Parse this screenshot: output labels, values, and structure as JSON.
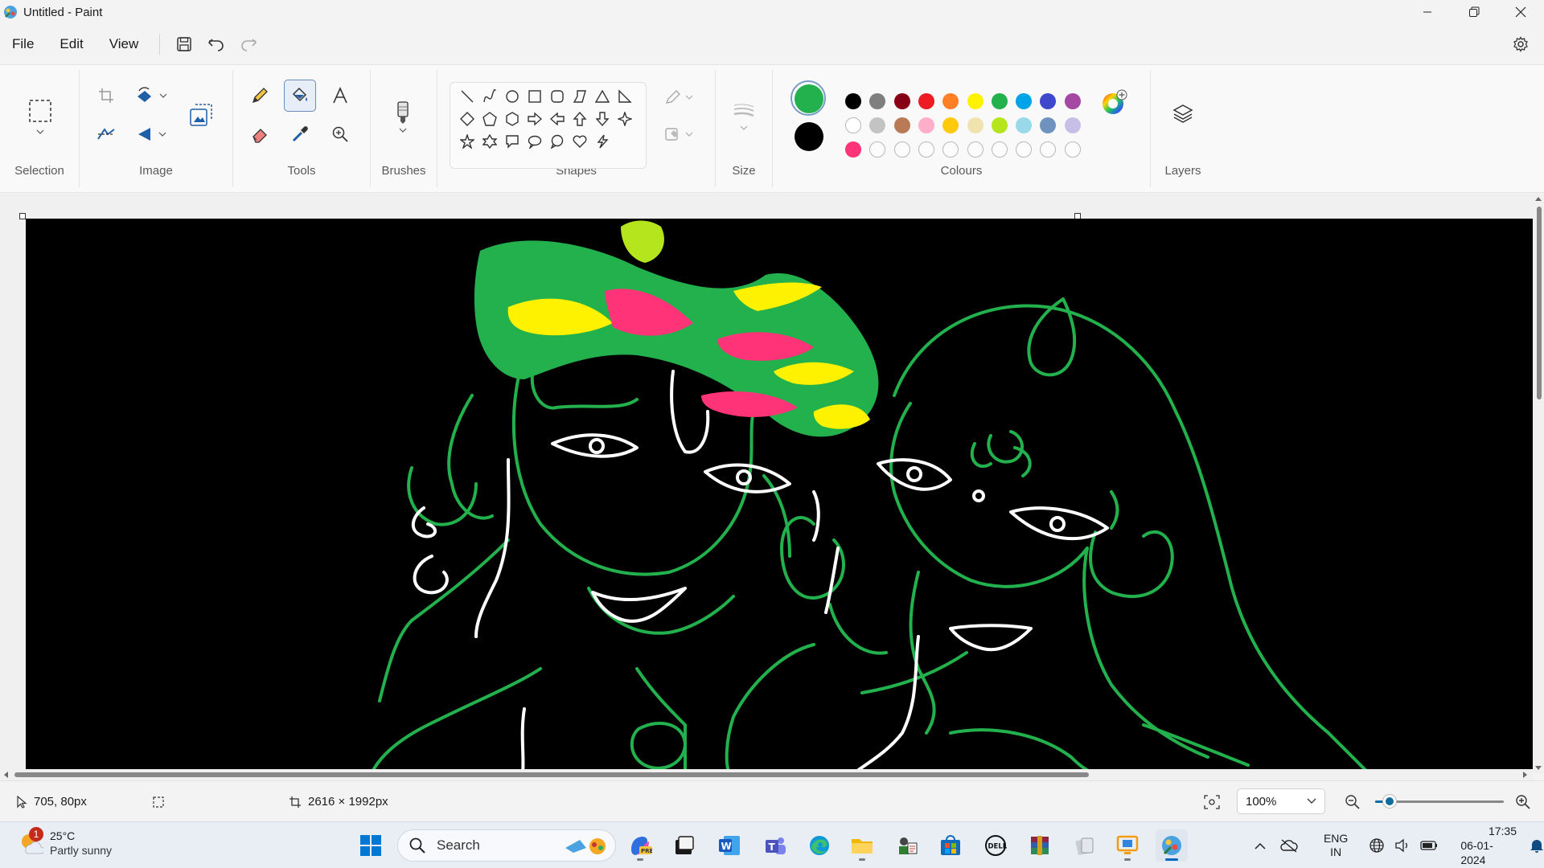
{
  "window": {
    "title": "Untitled - Paint"
  },
  "menu": {
    "file": "File",
    "edit": "Edit",
    "view": "View"
  },
  "ribbon": {
    "selection_label": "Selection",
    "image_label": "Image",
    "tools_label": "Tools",
    "brushes_label": "Brushes",
    "shapes_label": "Shapes",
    "size_label": "Size",
    "colours_label": "Colours",
    "layers_label": "Layers",
    "current_colors": {
      "primary": "#22b14c",
      "secondary": "#000000"
    },
    "palette_row1": [
      "#000000",
      "#7f7f7f",
      "#880015",
      "#ed1c24",
      "#ff7f27",
      "#fff200",
      "#22b14c",
      "#00a2e8",
      "#3f48cc",
      "#a349a4"
    ],
    "palette_row2": [
      "#ffffff",
      "#c3c3c3",
      "#b97a57",
      "#ffaec9",
      "#ffc90e",
      "#efe4b0",
      "#b5e61d",
      "#99d9ea",
      "#7092be",
      "#c8bfe7"
    ],
    "palette_row3": [
      "#ff3377",
      "",
      "",
      "",
      "",
      "",
      "",
      "",
      "",
      ""
    ]
  },
  "status": {
    "cursor_position": "705, 80px",
    "canvas_size": "2616 × 1992px",
    "zoom": "100%",
    "zoom_slider_fraction": 0.11
  },
  "taskbar": {
    "weather_temp": "25°C",
    "weather_desc": "Partly sunny",
    "weather_badge": "1",
    "search_placeholder": "Search",
    "lang_line1": "ENG",
    "lang_line2": "IN",
    "time": "17:35",
    "date": "06-01-2024"
  }
}
